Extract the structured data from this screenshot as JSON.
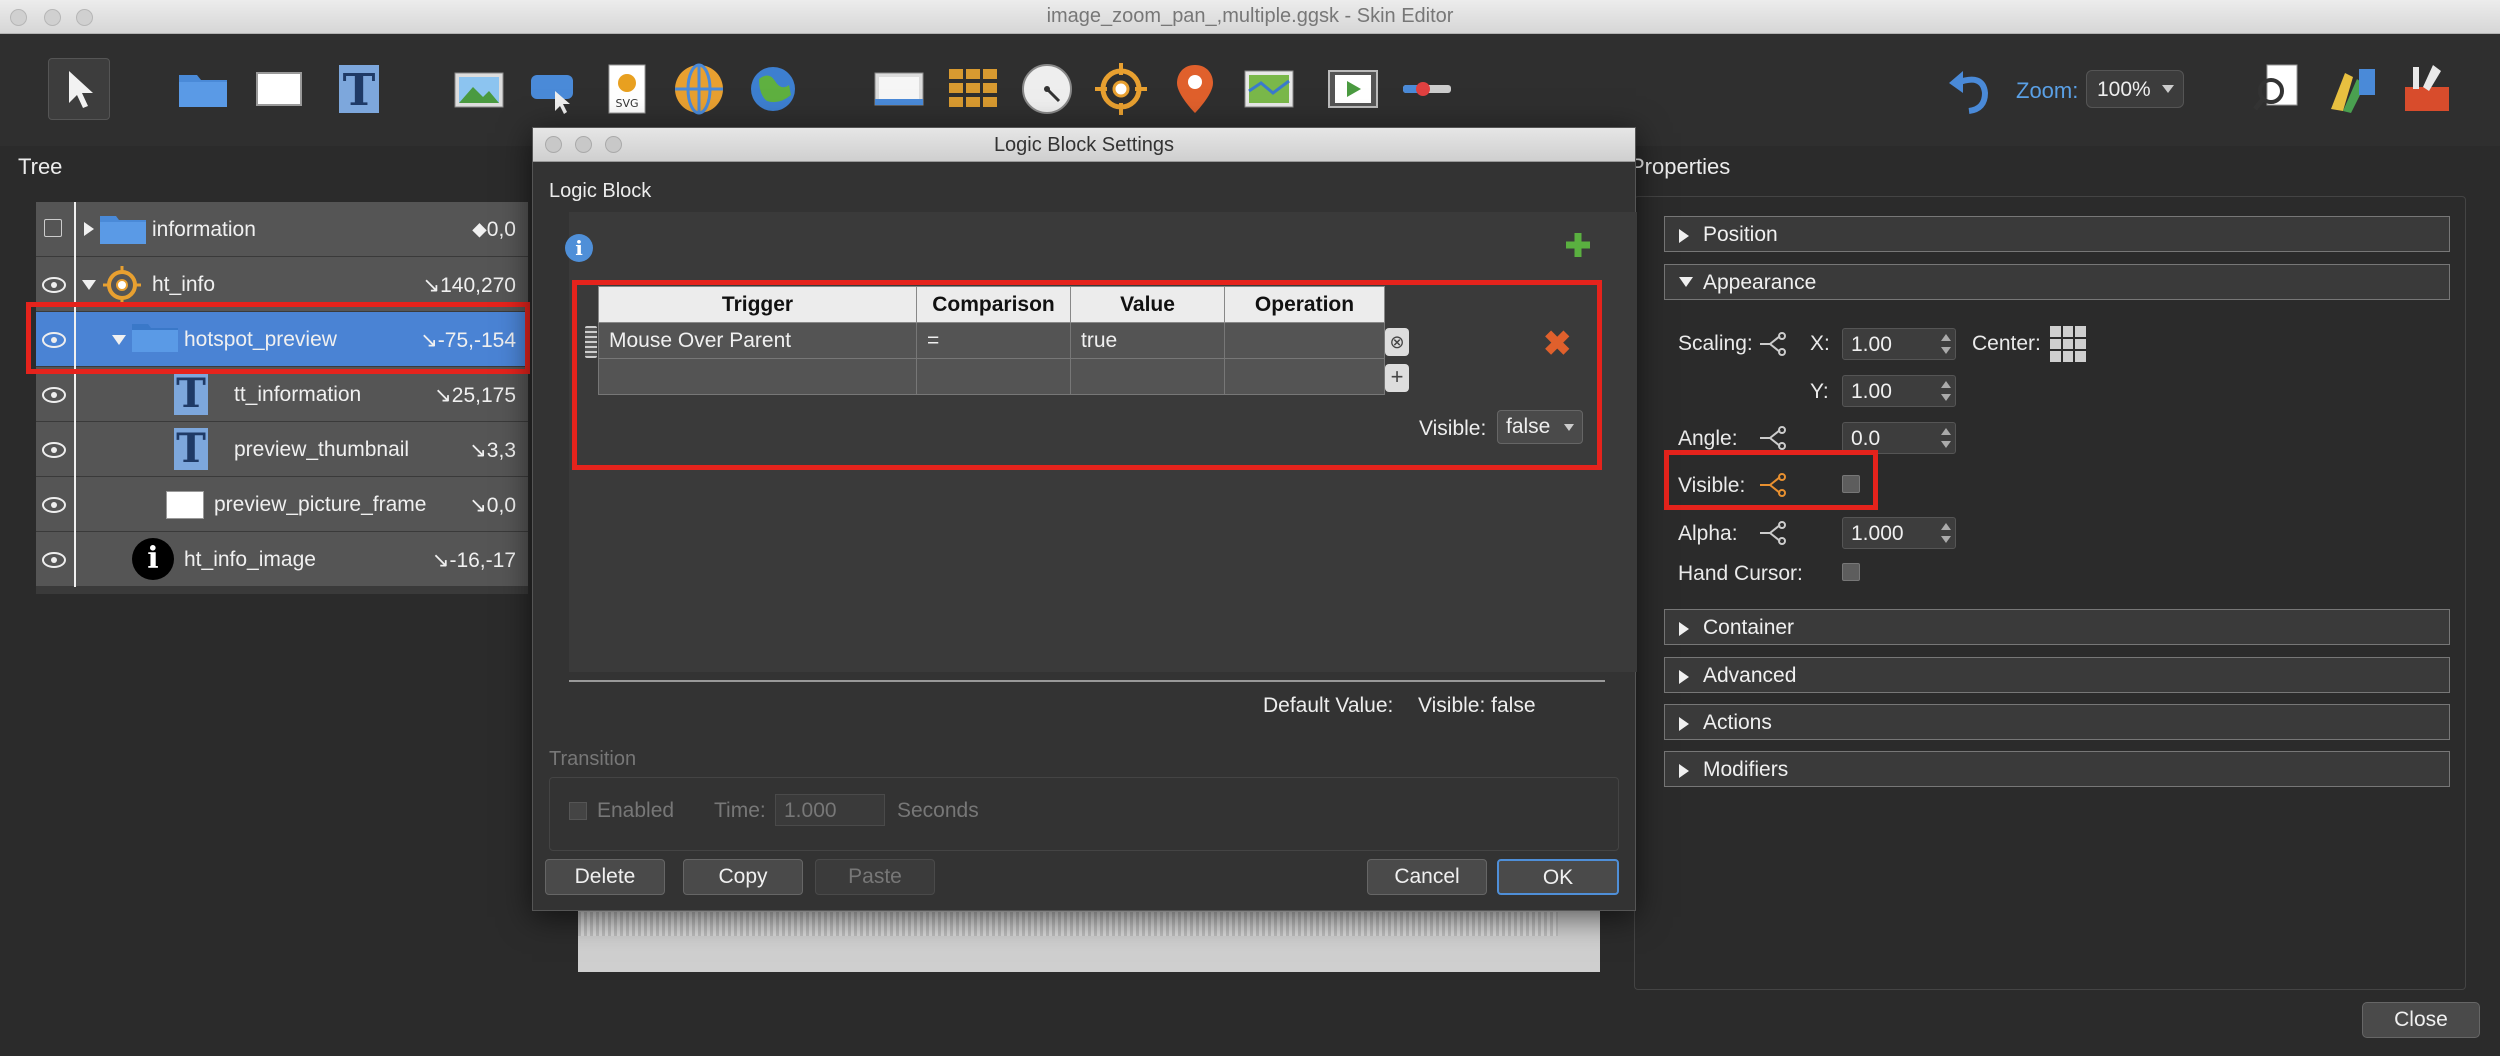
{
  "window": {
    "title": "image_zoom_pan_,multiple.ggsk - Skin Editor"
  },
  "toolbar": {
    "zoom_label": "Zoom:",
    "zoom_value": "100%",
    "icons": [
      "select-arrow-icon",
      "folder-icon",
      "rectangle-icon",
      "text-icon",
      "image-icon",
      "cloud-icon",
      "svg-icon",
      "panorama-icon",
      "globe-icon",
      "screen-icon",
      "grid-icon",
      "dial-icon",
      "crosshair-icon",
      "map-pin-icon",
      "map-icon",
      "video-icon",
      "slider-icon",
      "undo-icon",
      "search-icon",
      "palette-icon",
      "tools-icon"
    ]
  },
  "tree": {
    "label": "Tree",
    "rows": [
      {
        "name": "information",
        "coord": "⬥0,0"
      },
      {
        "name": "ht_info",
        "coord": "↘140,270"
      },
      {
        "name": "hotspot_preview",
        "coord": "↘-75,-154"
      },
      {
        "name": "tt_information",
        "coord": "↘25,175"
      },
      {
        "name": "preview_thumbnail",
        "coord": "↘3,3"
      },
      {
        "name": "preview_picture_frame",
        "coord": "↘0,0"
      },
      {
        "name": "ht_info_image",
        "coord": "↘-16,-17"
      }
    ]
  },
  "dialog": {
    "title": "Logic Block Settings",
    "section_label": "Logic Block",
    "table": {
      "headers": [
        "Trigger",
        "Comparison",
        "Value",
        "Operation"
      ],
      "rows": [
        [
          "Mouse Over Parent",
          "=",
          "true",
          ""
        ],
        [
          "",
          "",
          "",
          ""
        ]
      ]
    },
    "visible_label": "Visible:",
    "visible_value": "false",
    "default_value_label": "Default Value:",
    "default_visible": "Visible:  false",
    "transition_label": "Transition",
    "enabled_label": "Enabled",
    "time_label": "Time:",
    "time_value": "1.000",
    "seconds_label": "Seconds",
    "buttons": {
      "delete": "Delete",
      "copy": "Copy",
      "paste": "Paste",
      "cancel": "Cancel",
      "ok": "OK"
    }
  },
  "properties": {
    "label": "Properties",
    "sections": {
      "position": "Position",
      "appearance": "Appearance",
      "container": "Container",
      "advanced": "Advanced",
      "actions": "Actions",
      "modifiers": "Modifiers"
    },
    "scaling_label": "Scaling:",
    "x_label": "X:",
    "x_value": "1.00",
    "y_label": "Y:",
    "y_value": "1.00",
    "center_label": "Center:",
    "angle_label": "Angle:",
    "angle_value": "0.0",
    "visible_label": "Visible:",
    "alpha_label": "Alpha:",
    "alpha_value": "1.000",
    "hand_cursor_label": "Hand Cursor:"
  },
  "close_label": "Close",
  "colors": {
    "highlight_red": "#e5231c",
    "selection_blue": "#4a83d4",
    "accent_orange": "#e0602c"
  }
}
